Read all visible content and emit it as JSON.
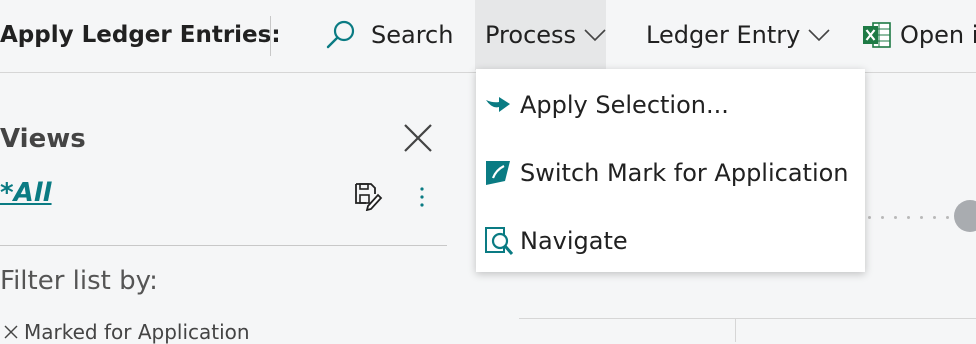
{
  "header": {
    "title": "Apply Ledger Entries:",
    "actions": {
      "search": "Search",
      "process": "Process",
      "ledger_entry": "Ledger Entry",
      "open_in": "Open in"
    }
  },
  "process_menu": {
    "items": [
      {
        "label": "Apply Selection...",
        "icon": "apply-arrow-icon"
      },
      {
        "label": "Switch Mark for Application",
        "icon": "mark-flag-icon"
      },
      {
        "label": "Navigate",
        "icon": "navigate-icon"
      }
    ]
  },
  "views_pane": {
    "title": "Views",
    "current_view": "*All",
    "filter_label": "Filter list by:",
    "filter_chip": "Marked for Application"
  },
  "colors": {
    "accent": "#0a7b83",
    "excel_green": "#1e7a45",
    "background": "#f5f6f7"
  }
}
